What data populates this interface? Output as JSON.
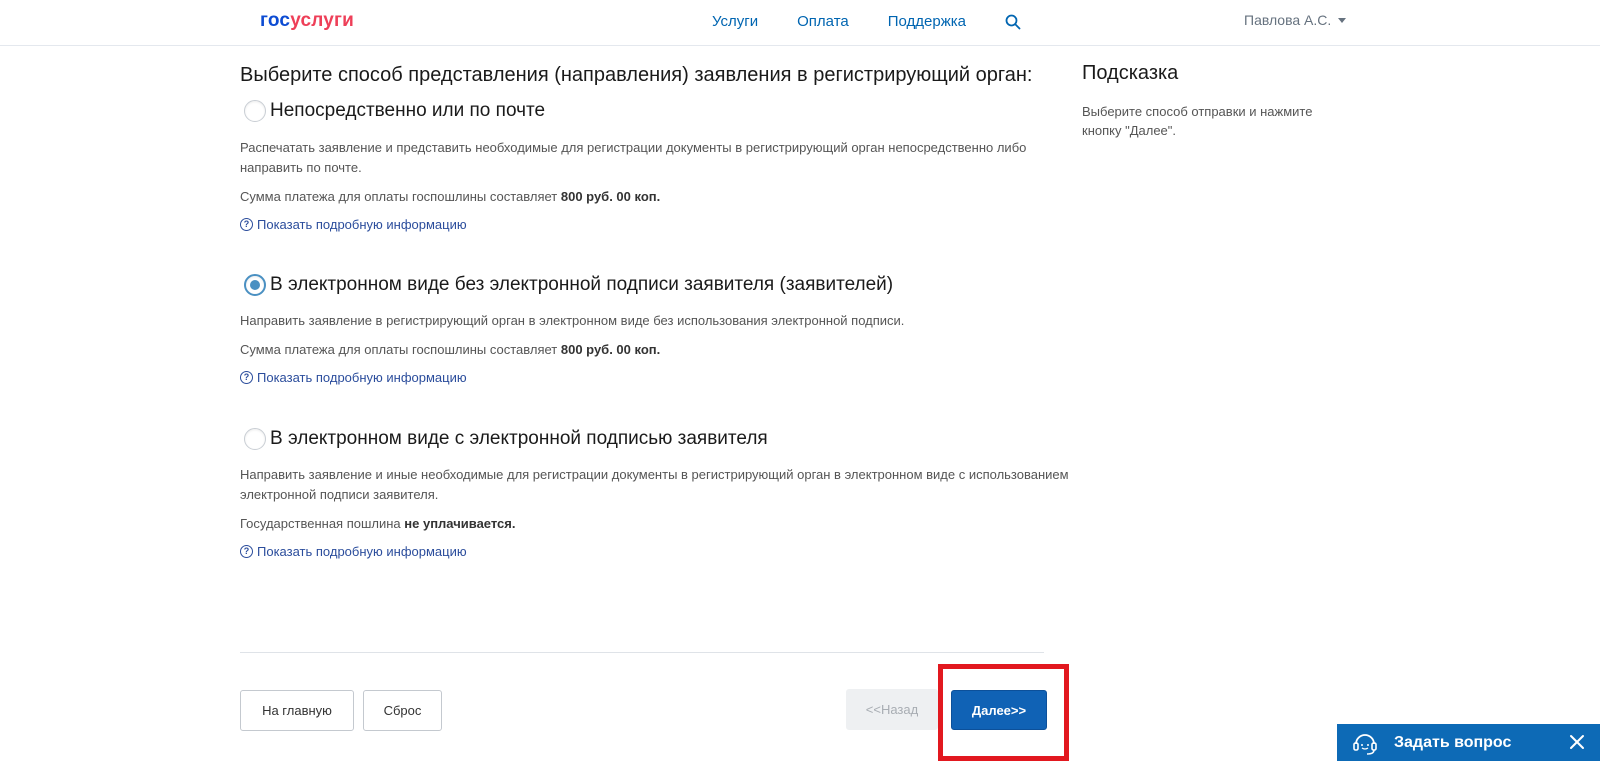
{
  "header": {
    "logo_part1": "гос",
    "logo_part2": "услуги",
    "nav": [
      "Услуги",
      "Оплата",
      "Поддержка"
    ],
    "user_name": "Павлова А.С."
  },
  "main": {
    "title": "Выберите способ представления (направления) заявления в регистрирующий орган:",
    "options": [
      {
        "label": "Непосредственно или по почте",
        "checked": false,
        "description": "Распечатать заявление и представить необходимые для регистрации документы в регистрирующий орган непосредственно либо направить по почте.",
        "fee_prefix": "Сумма платежа для оплаты госпошлины составляет ",
        "fee_bold": "800 руб. 00 коп.",
        "more_link": "Показать подробную информацию"
      },
      {
        "label": "В электронном виде без электронной подписи заявителя (заявителей)",
        "checked": true,
        "description": "Направить заявление в регистрирующий орган в электронном виде без использования электронной подписи.",
        "fee_prefix": "Сумма платежа для оплаты госпошлины составляет ",
        "fee_bold": "800 руб. 00 коп.",
        "more_link": "Показать подробную информацию"
      },
      {
        "label": "В электронном виде с электронной подписью заявителя",
        "checked": false,
        "description": "Направить заявление и иные необходимые для регистрации документы в регистрирующий орган в электронном виде с использованием электронной подписи заявителя.",
        "fee_prefix": "Государственная пошлина ",
        "fee_bold": "не уплачивается.",
        "more_link": "Показать подробную информацию"
      }
    ]
  },
  "buttons": {
    "home": "На главную",
    "reset": "Сброс",
    "back": "<<Назад",
    "next": "Далее>>"
  },
  "hint": {
    "title": "Подсказка",
    "text": "Выберите способ отправки и нажмите кнопку \"Далее\"."
  },
  "chat": {
    "label": "Задать вопрос"
  },
  "colors": {
    "brand_blue": "#0d4cd3",
    "brand_red": "#ee3f58",
    "link": "#0065b1",
    "primary_button": "#1062b5",
    "highlight": "#e2181f",
    "chat_bg": "#0d6ab6"
  }
}
